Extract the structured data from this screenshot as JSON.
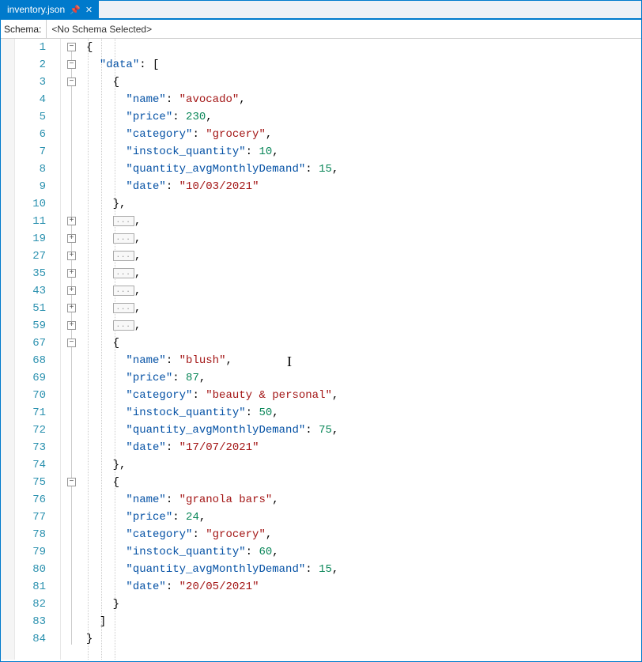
{
  "tab": {
    "filename": "inventory.json",
    "pin_glyph": "⇪",
    "close_glyph": "✕"
  },
  "schema": {
    "label": "Schema:",
    "value": "<No Schema Selected>"
  },
  "line_numbers": [
    "1",
    "2",
    "3",
    "4",
    "5",
    "6",
    "7",
    "8",
    "9",
    "10",
    "11",
    "19",
    "27",
    "35",
    "43",
    "51",
    "59",
    "67",
    "68",
    "69",
    "70",
    "71",
    "72",
    "73",
    "74",
    "75",
    "76",
    "77",
    "78",
    "79",
    "80",
    "81",
    "82",
    "83",
    "84"
  ],
  "fold_rows": {
    "minus": [
      0,
      1,
      2,
      17,
      25
    ],
    "plus": [
      10,
      11,
      12,
      13,
      14,
      15,
      16
    ]
  },
  "code": {
    "r3_key": "\"data\"",
    "r5_name_k": "\"name\"",
    "r5_name_v": "\"avocado\"",
    "r6_price_k": "\"price\"",
    "r6_price_v": "230",
    "r7_cat_k": "\"category\"",
    "r7_cat_v": "\"grocery\"",
    "r8_qty_k": "\"instock_quantity\"",
    "r8_qty_v": "10",
    "r9_dem_k": "\"quantity_avgMonthlyDemand\"",
    "r9_dem_v": "15",
    "r10_date_k": "\"date\"",
    "r10_date_v": "\"10/03/2021\"",
    "r19_name_v": "\"blush\"",
    "r20_price_v": "87",
    "r21_cat_v": "\"beauty & personal\"",
    "r22_qty_v": "50",
    "r23_dem_v": "75",
    "r24_date_v": "\"17/07/2021\"",
    "r27_name_v": "\"granola bars\"",
    "r28_price_v": "24",
    "r29_cat_v": "\"grocery\"",
    "r30_qty_v": "60",
    "r31_dem_v": "15",
    "r32_date_v": "\"20/05/2021\"",
    "collapsed": "..."
  }
}
